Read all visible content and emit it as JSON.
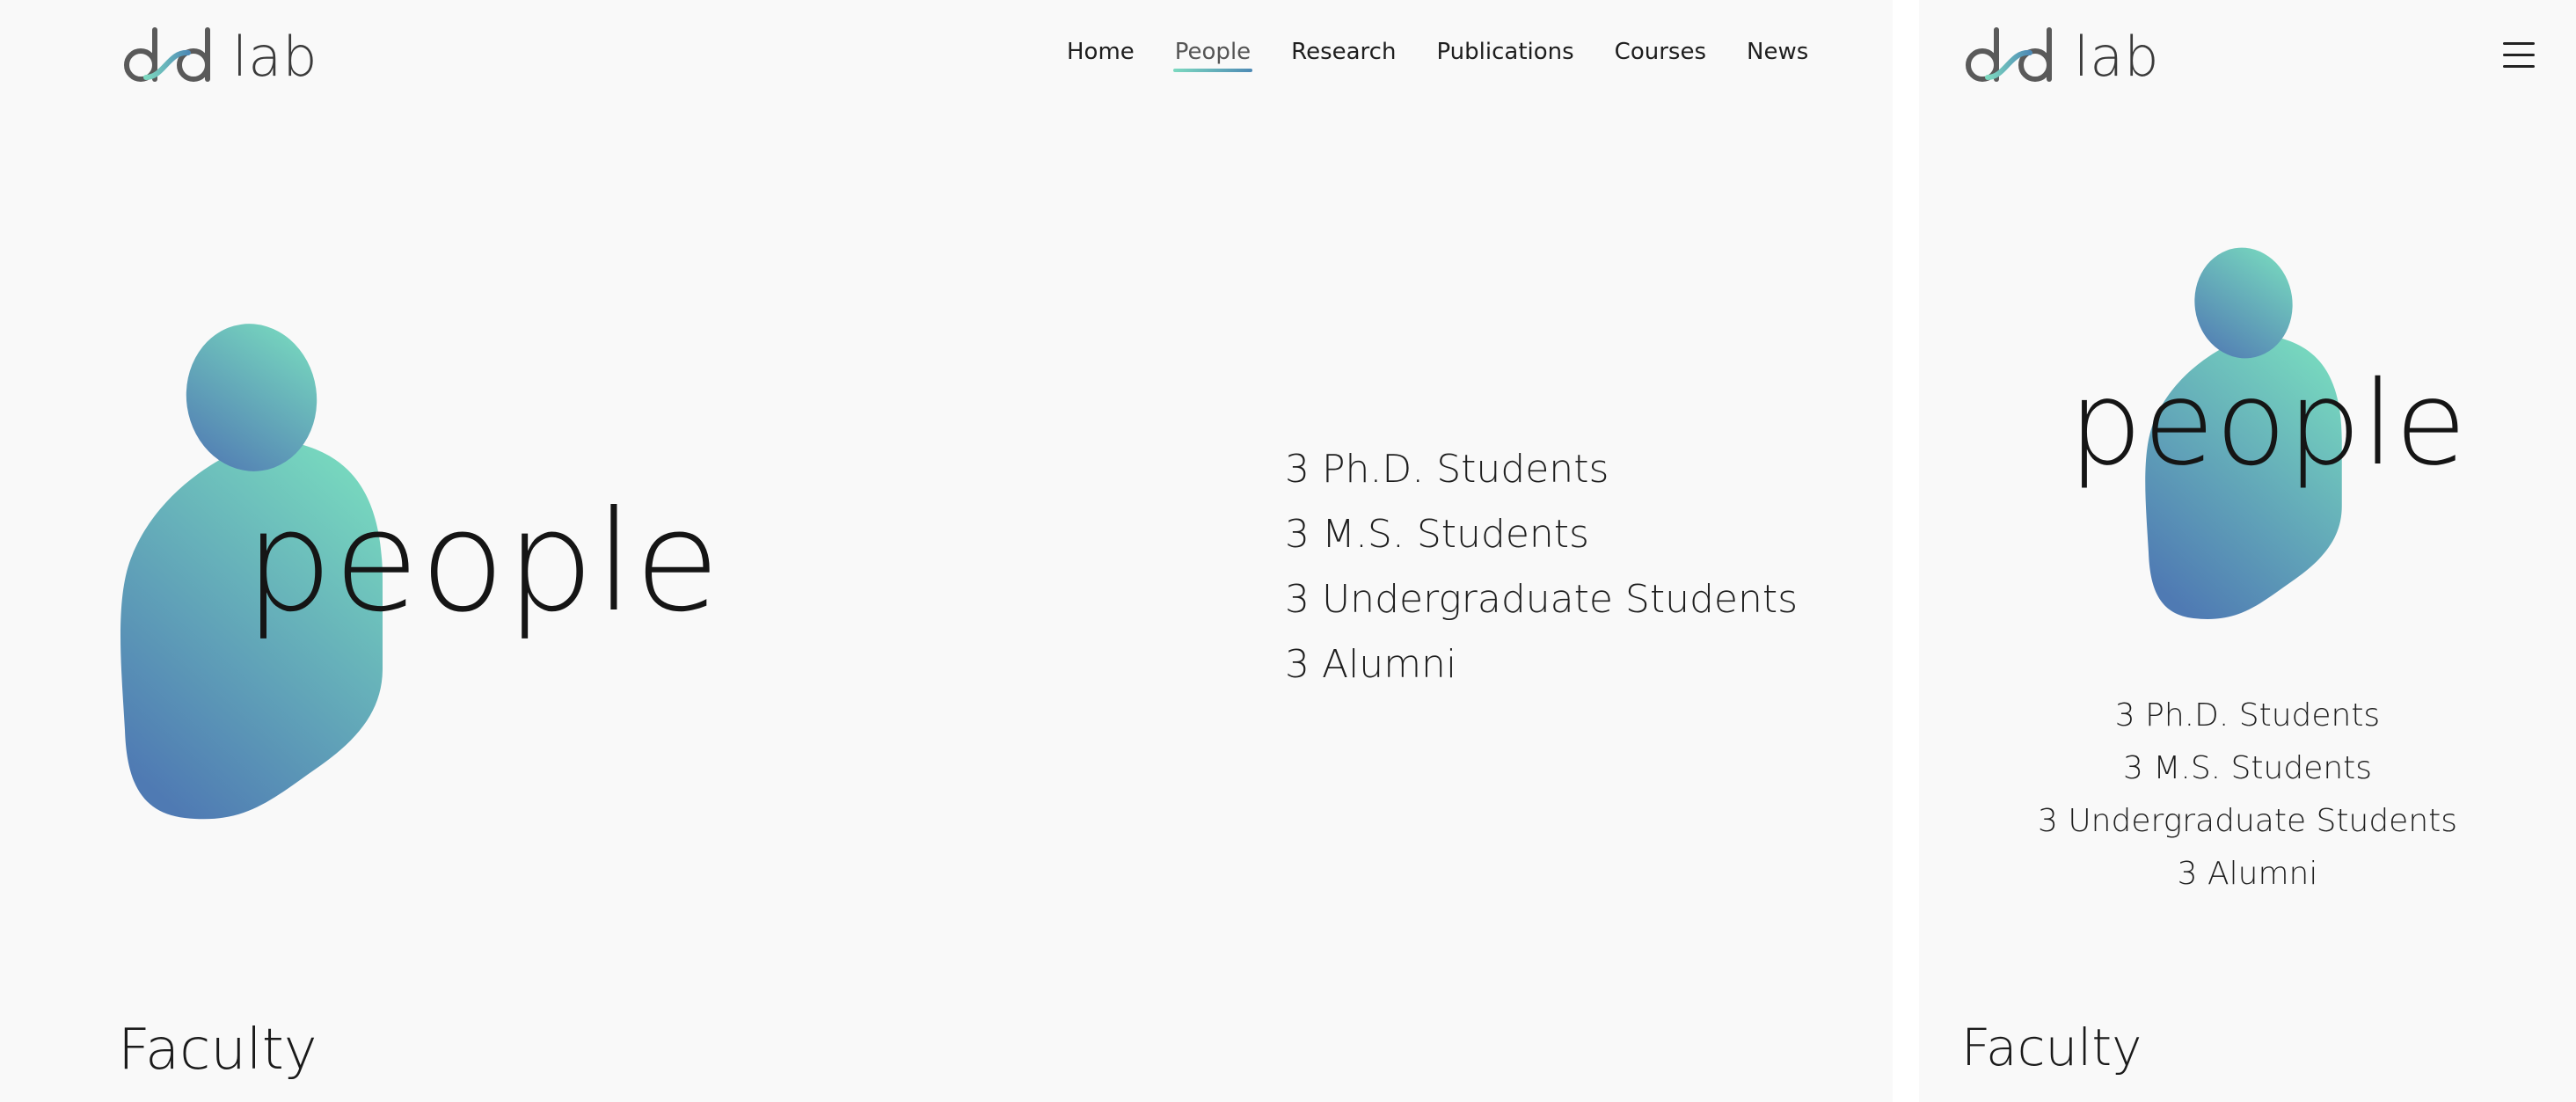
{
  "logo": {
    "wordmark": "lab",
    "icon": "dxd-logo-icon"
  },
  "nav": {
    "items": [
      {
        "label": "Home"
      },
      {
        "label": "People",
        "active": true
      },
      {
        "label": "Research"
      },
      {
        "label": "Publications"
      },
      {
        "label": "Courses"
      },
      {
        "label": "News"
      }
    ]
  },
  "hero": {
    "title": "people"
  },
  "stats": [
    "3 Ph.D. Students",
    "3 M.S. Students",
    "3 Undergraduate Students",
    "3 Alumni"
  ],
  "sections": {
    "faculty": "Faculty"
  },
  "mobile": {
    "menu_icon": "hamburger-menu-icon"
  },
  "colors": {
    "gradient_teal": "#79dcbf",
    "gradient_blue": "#4f7ab3",
    "background": "#f9f9f9"
  }
}
